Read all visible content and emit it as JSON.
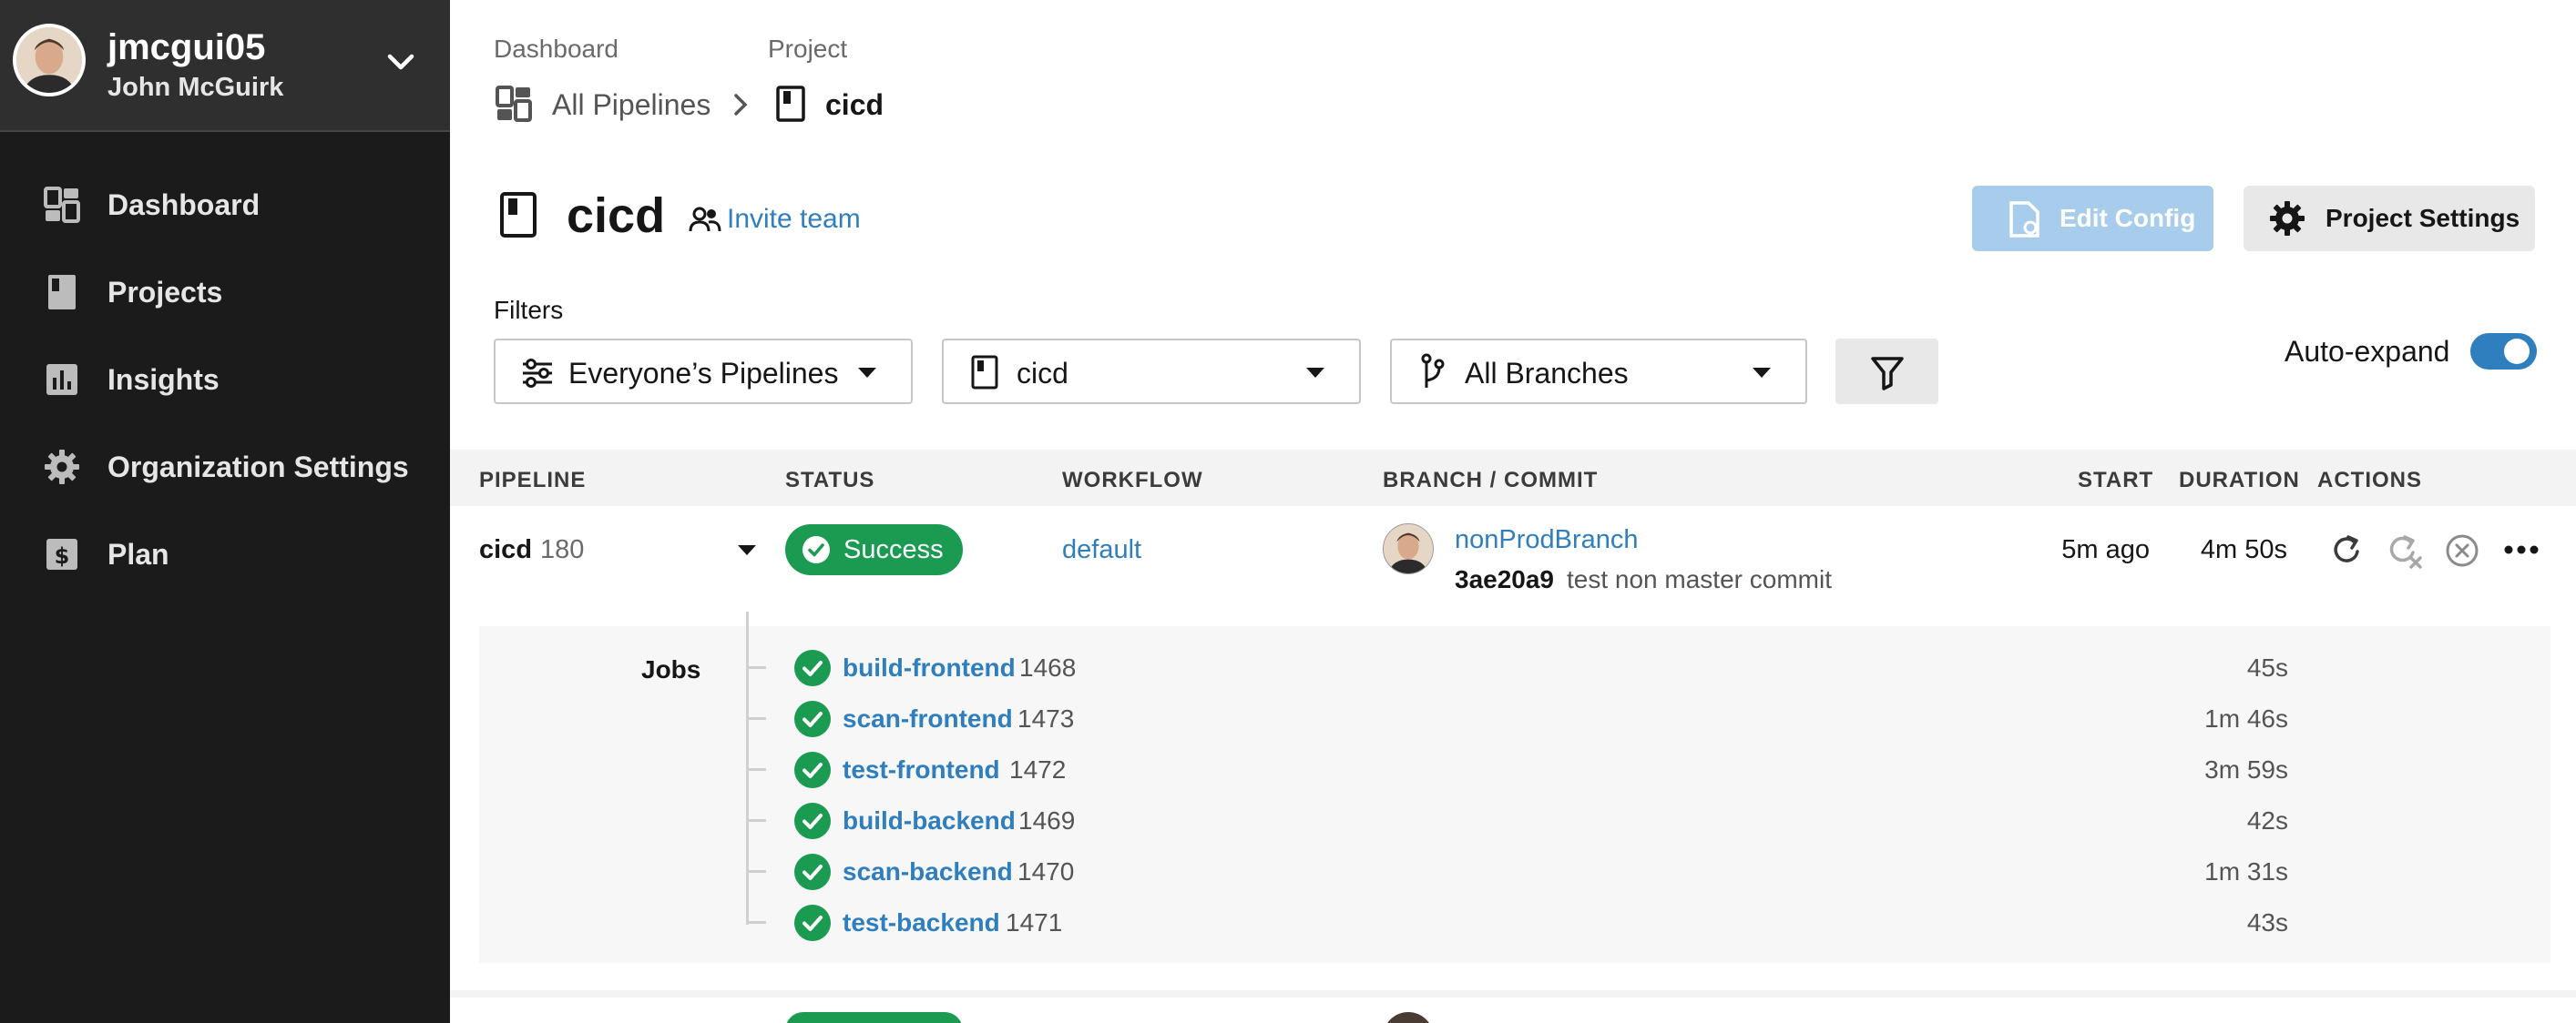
{
  "user": {
    "username": "jmcgui05",
    "full_name": "John McGuirk"
  },
  "sidebar": {
    "items": [
      {
        "label": "Dashboard",
        "icon": "dashboard-icon"
      },
      {
        "label": "Projects",
        "icon": "projects-icon"
      },
      {
        "label": "Insights",
        "icon": "insights-icon"
      },
      {
        "label": "Organization Settings",
        "icon": "gear-icon"
      },
      {
        "label": "Plan",
        "icon": "plan-icon"
      }
    ]
  },
  "breadcrumb": {
    "dashboard_label": "Dashboard",
    "project_label": "Project",
    "all_pipelines": "All Pipelines",
    "project_name": "cicd"
  },
  "header": {
    "title": "cicd",
    "invite_label": "Invite team",
    "edit_config_label": "Edit Config",
    "project_settings_label": "Project Settings"
  },
  "filters": {
    "label": "Filters",
    "pipelines": "Everyone’s Pipelines",
    "project": "cicd",
    "branches": "All Branches",
    "auto_expand_label": "Auto-expand",
    "auto_expand_on": true
  },
  "table": {
    "headers": [
      "PIPELINE",
      "STATUS",
      "WORKFLOW",
      "BRANCH / COMMIT",
      "START",
      "DURATION",
      "ACTIONS"
    ],
    "row": {
      "pipeline": "cicd",
      "number": "180",
      "status": "Success",
      "workflow": "default",
      "branch": "nonProdBranch",
      "sha": "3ae20a9",
      "commit_message": "test non master commit",
      "start": "5m ago",
      "duration": "4m 50s"
    },
    "jobs_label": "Jobs",
    "jobs": [
      {
        "name": "build-frontend",
        "number": "1468",
        "duration": "45s"
      },
      {
        "name": "scan-frontend",
        "number": "1473",
        "duration": "1m 46s"
      },
      {
        "name": "test-frontend",
        "number": "1472",
        "duration": "3m 59s"
      },
      {
        "name": "build-backend",
        "number": "1469",
        "duration": "42s"
      },
      {
        "name": "scan-backend",
        "number": "1470",
        "duration": "1m 31s"
      },
      {
        "name": "test-backend",
        "number": "1471",
        "duration": "43s"
      }
    ]
  },
  "colors": {
    "accent": "#2f7ebd",
    "success": "#1b9a52",
    "sidebar": "#1b1b1b"
  }
}
